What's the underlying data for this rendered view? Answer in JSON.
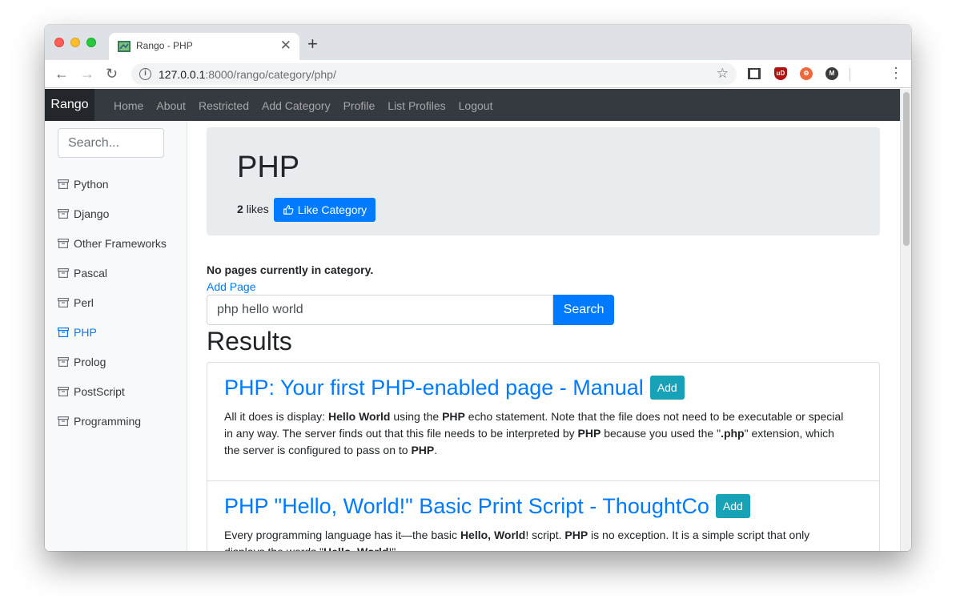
{
  "browser": {
    "tab_title": "Rango - PHP",
    "tab_close": "✕",
    "new_tab": "+",
    "url_host": "127.0.0.1",
    "url_rest": ":8000/rango/category/php/",
    "ext_ub_label": "uD",
    "ext_m_label": "M"
  },
  "navbar": {
    "brand": "Rango",
    "links": [
      "Home",
      "About",
      "Restricted",
      "Add Category",
      "Profile",
      "List Profiles",
      "Logout"
    ]
  },
  "sidebar": {
    "search_placeholder": "Search...",
    "categories": [
      {
        "label": "Python"
      },
      {
        "label": "Django"
      },
      {
        "label": "Other Frameworks"
      },
      {
        "label": "Pascal"
      },
      {
        "label": "Perl"
      },
      {
        "label": "PHP",
        "active": true
      },
      {
        "label": "Prolog"
      },
      {
        "label": "PostScript"
      },
      {
        "label": "Programming"
      }
    ]
  },
  "category": {
    "title": "PHP",
    "likes_count": "2",
    "likes_word": "likes",
    "like_button": "Like Category"
  },
  "pages": {
    "empty_message": "No pages currently in category.",
    "add_page_link": "Add Page"
  },
  "search": {
    "query": "php hello world",
    "button": "Search"
  },
  "results": {
    "heading": "Results",
    "add_label": "Add",
    "items": [
      {
        "title": "PHP: Your first PHP-enabled page - Manual",
        "snippet_parts": [
          {
            "t": "All it does is display: "
          },
          {
            "t": "Hello World",
            "b": true
          },
          {
            "t": " using the "
          },
          {
            "t": "PHP",
            "b": true
          },
          {
            "t": " echo statement. Note that the file does not need to be executable or special in any way. The server finds out that this file needs to be interpreted by "
          },
          {
            "t": "PHP",
            "b": true
          },
          {
            "t": " because you used the \""
          },
          {
            "t": ".php",
            "b": true
          },
          {
            "t": "\" extension, which the server is configured to pass on to "
          },
          {
            "t": "PHP",
            "b": true
          },
          {
            "t": "."
          }
        ]
      },
      {
        "title": "PHP \"Hello, World!\" Basic Print Script - ThoughtCo",
        "snippet_parts": [
          {
            "t": "Every programming language has it—the basic "
          },
          {
            "t": "Hello, World",
            "b": true
          },
          {
            "t": "! script. "
          },
          {
            "t": "PHP",
            "b": true
          },
          {
            "t": " is no exception. It is a simple script that only displays the words \""
          },
          {
            "t": "Hello, World",
            "b": true
          },
          {
            "t": "!\""
          }
        ]
      }
    ]
  },
  "colors": {
    "primary": "#007bff",
    "info": "#17a2b8",
    "navbar_bg": "#343a40",
    "jumbotron_bg": "#e9ecef"
  }
}
